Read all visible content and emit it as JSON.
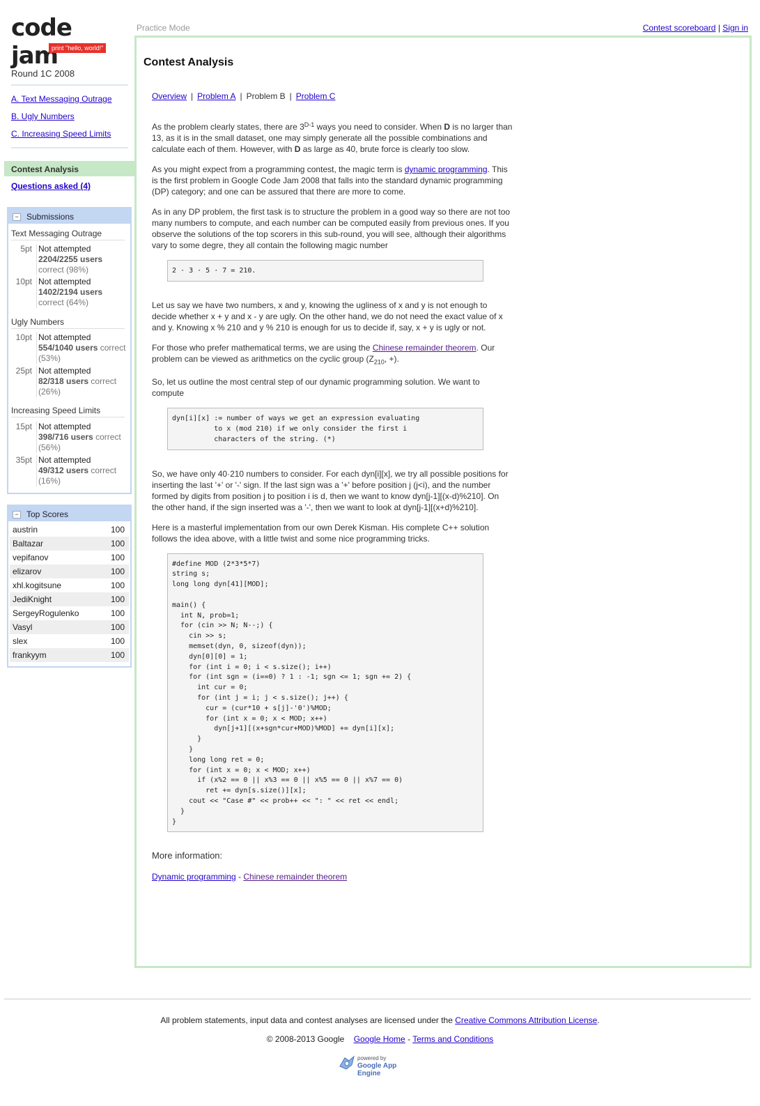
{
  "logo": {
    "text": "code jam",
    "tagline": "print \"hello, world!\""
  },
  "round": "Round 1C 2008",
  "problems": [
    {
      "label": "A. Text Messaging Outrage"
    },
    {
      "label": "B. Ugly Numbers"
    },
    {
      "label": "C. Increasing Speed Limits"
    }
  ],
  "nav": {
    "analysis": "Contest Analysis",
    "questions": "Questions asked (4)"
  },
  "submissions": {
    "title": "Submissions",
    "problems": [
      {
        "name": "Text Messaging Outrage",
        "rows": [
          {
            "pts": "5pt",
            "status": "Not attempted",
            "ratio": "2204/2255 users",
            "correct": "correct (98%)"
          },
          {
            "pts": "10pt",
            "status": "Not attempted",
            "ratio": "1402/2194 users",
            "correct": "correct (64%)"
          }
        ]
      },
      {
        "name": "Ugly Numbers",
        "rows": [
          {
            "pts": "10pt",
            "status": "Not attempted",
            "ratio": "554/1040 users",
            "correct_inline": "correct",
            "correct": "(53%)"
          },
          {
            "pts": "25pt",
            "status": "Not attempted",
            "ratio": "82/318 users",
            "correct_inline": "correct",
            "correct": "(26%)"
          }
        ]
      },
      {
        "name": "Increasing Speed Limits",
        "rows": [
          {
            "pts": "15pt",
            "status": "Not attempted",
            "ratio": "398/716 users",
            "correct_inline": "correct",
            "correct": "(56%)"
          },
          {
            "pts": "35pt",
            "status": "Not attempted",
            "ratio": "49/312 users",
            "correct_inline": "correct",
            "correct": "(16%)"
          }
        ]
      }
    ]
  },
  "top_scores": {
    "title": "Top Scores",
    "rows": [
      {
        "name": "austrin",
        "score": "100"
      },
      {
        "name": "Baltazar",
        "score": "100"
      },
      {
        "name": "vepifanov",
        "score": "100"
      },
      {
        "name": "elizarov",
        "score": "100"
      },
      {
        "name": "xhl.kogitsune",
        "score": "100"
      },
      {
        "name": "JediKnight",
        "score": "100"
      },
      {
        "name": "SergeyRogulenko",
        "score": "100"
      },
      {
        "name": "Vasyl",
        "score": "100"
      },
      {
        "name": "slex",
        "score": "100"
      },
      {
        "name": "frankyym",
        "score": "100"
      }
    ]
  },
  "topbar": {
    "mode": "Practice Mode",
    "scoreboard": "Contest scoreboard",
    "sep": "|",
    "signin": "Sign in"
  },
  "main": {
    "title": "Contest Analysis",
    "tabs": {
      "overview": "Overview",
      "a": "Problem A",
      "b": "Problem B",
      "c": "Problem C",
      "sep": "|"
    },
    "p1": {
      "a": "As the problem clearly states, there are 3",
      "sup": "D-1",
      "b": " ways you need to consider. When ",
      "d1": "D",
      "c": " is no larger than 13, as it is in the small dataset, one may simply generate all the possible combinations and calculate each of them. However, with ",
      "d2": "D",
      "e": " as large as 40, brute force is clearly too slow."
    },
    "p2": {
      "a": "As you might expect from a programming contest, the magic term is ",
      "link": "dynamic programming",
      "b": ". This is the first problem in Google Code Jam 2008 that falls into the standard dynamic programming (DP) category; and one can be assured that there are more to come."
    },
    "p3": "As in any DP problem, the first task is to structure the problem in a good way so there are not too many numbers to compute, and each number can be computed easily from previous ones. If you observe the solutions of the top scorers in this sub-round, you will see, although their algorithms vary to some degre, they all contain the following magic number",
    "code1": "2 · 3 · 5 · 7 = 210.",
    "p4": "Let us say we have two numbers, x and y, knowing the ugliness of x and y is not enough to decide whether x + y and x - y are ugly. On the other hand, we do not need the exact value of x and y. Knowing x % 210 and y % 210 is enough for us to decide if, say, x + y is ugly or not.",
    "p5": {
      "a": "For those who prefer mathematical terms, we are using the ",
      "link": "Chinese remainder theorem",
      "b": ". Our problem can be viewed as arithmetics on the cyclic group (Z",
      "sub": "210",
      "c": ", +)."
    },
    "p6": "So, let us outline the most central step of our dynamic programming solution. We want to compute",
    "code2": "dyn[i][x] := number of ways we get an expression evaluating\n          to x (mod 210) if we only consider the first i\n          characters of the string. (*)",
    "p7": "So, we have only 40·210 numbers to consider. For each dyn[i][x], we try all possible positions for inserting the last '+' or '-' sign. If the last sign was a '+' before position j (j<i), and the number formed by digits from position j to position i is d, then we want to know dyn[j-1][(x-d)%210]. On the other hand, if the sign inserted was a '-', then we want to look at dyn[j-1][(x+d)%210].",
    "p8": "Here is a masterful implementation from our own Derek Kisman. His complete C++ solution follows the idea above, with a little twist and some nice programming tricks.",
    "code3": "#define MOD (2*3*5*7)\nstring s;\nlong long dyn[41][MOD];\n\nmain() {\n  int N, prob=1;\n  for (cin >> N; N--;) {\n    cin >> s;\n    memset(dyn, 0, sizeof(dyn));\n    dyn[0][0] = 1;\n    for (int i = 0; i < s.size(); i++)\n    for (int sgn = (i==0) ? 1 : -1; sgn <= 1; sgn += 2) {\n      int cur = 0;\n      for (int j = i; j < s.size(); j++) {\n        cur = (cur*10 + s[j]-'0')%MOD;\n        for (int x = 0; x < MOD; x++)\n          dyn[j+1][(x+sgn*cur+MOD)%MOD] += dyn[i][x];\n      }\n    }\n    long long ret = 0;\n    for (int x = 0; x < MOD; x++)\n      if (x%2 == 0 || x%3 == 0 || x%5 == 0 || x%7 == 0)\n        ret += dyn[s.size()][x];\n    cout << \"Case #\" << prob++ << \": \" << ret << endl;\n  }\n}",
    "more_title": "More information:",
    "more": {
      "link1": "Dynamic programming",
      "sep": " - ",
      "link2": "Chinese remainder theorem"
    }
  },
  "footer": {
    "license_text": "All problem statements, input data and contest analyses are licensed under the ",
    "license_link": "Creative Commons Attribution License",
    "license_end": ".",
    "copyright": "© 2008-2013 Google",
    "home": "Google Home",
    "dash": " - ",
    "terms": "Terms and Conditions",
    "powered": "powered by",
    "engine": "Google App Engine"
  },
  "colors": {
    "accent_green": "#c6e8c6",
    "box_blue": "#c3d6f2",
    "logo_red": "#e8302a",
    "link": "#2200cc"
  }
}
